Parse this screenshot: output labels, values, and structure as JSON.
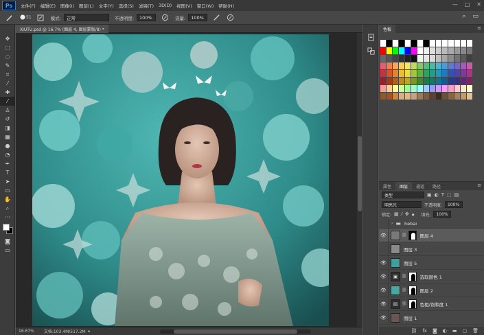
{
  "menubar": {
    "logo": "Ps",
    "items": [
      "文件(F)",
      "编辑(E)",
      "图像(I)",
      "图层(L)",
      "文字(Y)",
      "选择(S)",
      "滤镜(T)",
      "3D(D)",
      "视图(V)",
      "窗口(W)",
      "帮助(H)"
    ],
    "controls": [
      "—",
      "□",
      "✕"
    ]
  },
  "options": {
    "brush_size": "51",
    "mode_label": "模式:",
    "mode_value": "正常",
    "opacity_label": "不透明度:",
    "opacity_value": "100%",
    "flow_label": "流量:",
    "flow_value": "100%"
  },
  "document": {
    "tab_title": "XIUTU.psd @ 16.7% (图层 4, 图层蒙版/8) *",
    "zoom": "16.67%",
    "doc_info": "文档:103.4M/517.2M"
  },
  "swatches_panel": {
    "tab": "色板",
    "rows": [
      [
        "#ffffff",
        "#000000",
        "#ffffff",
        "#000000",
        "#ffffff",
        "#000000",
        "#ffffff",
        "#000000",
        "#ffffff",
        "#ffffff",
        "#ffffff",
        "#ffffff",
        "#ffffff",
        "#ffffff",
        "#ffffff"
      ],
      [
        "#ff0000",
        "#ffff00",
        "#00ff00",
        "#00ffff",
        "#0000ff",
        "#ff00ff",
        "#ffffff",
        "#eeeeee",
        "#dddddd",
        "#cccccc",
        "#bbbbbb",
        "#aaaaaa",
        "#999999",
        "#888888",
        "#777777"
      ],
      [
        "#666666",
        "#555555",
        "#444444",
        "#333333",
        "#222222",
        "#111111",
        "#f2f2f2",
        "#e6e6e6",
        "#d9d9d9",
        "#bfbfbf",
        "#a6a6a6",
        "#8c8c8c",
        "#737373",
        "#595959",
        "#404040"
      ],
      [
        "#e35f6d",
        "#ec7f58",
        "#f4a65c",
        "#f9cf5f",
        "#f4e76a",
        "#bfd866",
        "#86c66a",
        "#5cb97a",
        "#4bb8a7",
        "#4db2cc",
        "#4f99d4",
        "#5b7bcc",
        "#7666bf",
        "#9c5fb5",
        "#c45fa3"
      ],
      [
        "#cc2f3f",
        "#d6542d",
        "#e5832f",
        "#efbc2f",
        "#ecdc37",
        "#a2c736",
        "#5db23b",
        "#2ea35a",
        "#1aa18d",
        "#1b9abd",
        "#1e7ac7",
        "#2e54b8",
        "#5142a8",
        "#7d399d",
        "#ab3485"
      ],
      [
        "#991f2b",
        "#a23b1d",
        "#b0601f",
        "#bb8c1f",
        "#b8a923",
        "#7a9922",
        "#428828",
        "#1e7b42",
        "#107969",
        "#10748e",
        "#145b96",
        "#1f3d89",
        "#3a2f7e",
        "#5c2975",
        "#7f2462"
      ],
      [
        "#ff9999",
        "#ffcc99",
        "#ffff99",
        "#ccff99",
        "#99ff99",
        "#99ffcc",
        "#99ffff",
        "#99ccff",
        "#9999ff",
        "#cc99ff",
        "#ff99ff",
        "#ff99cc",
        "#ffcccc",
        "#ffe5cc",
        "#ffffcc"
      ],
      [
        "#8b5a2b",
        "#a0522d",
        "#cd853f",
        "#d2b48c",
        "#deb887",
        "#c4a484",
        "#9c7b5b",
        "#7a5c3e",
        "#5c4033",
        "#3d2b1f",
        "#6b4f3a",
        "#876543",
        "#a68064",
        "#c19a6b",
        "#e0c097"
      ]
    ]
  },
  "layers_panel": {
    "tabs": [
      "图层",
      "通道",
      "路径"
    ],
    "kind_label": "类型",
    "blend_mode": "明亮光",
    "opacity_label": "不透明度:",
    "opacity_value": "100%",
    "lock_label": "锁定:",
    "fill_label": "填充:",
    "fill_value": "100%",
    "layers": [
      {
        "name": "hebai",
        "type": "group"
      },
      {
        "name": "图层 4",
        "selected": true
      },
      {
        "name": "图层 3"
      },
      {
        "name": "图层 5"
      },
      {
        "name": "选取颜色 1"
      },
      {
        "name": "图层 2"
      },
      {
        "name": "色相/饱和度 1"
      },
      {
        "name": "图层 1"
      }
    ],
    "footer_icons": [
      "链接",
      "fx",
      "蒙版",
      "调整",
      "组",
      "新建",
      "删除"
    ]
  }
}
